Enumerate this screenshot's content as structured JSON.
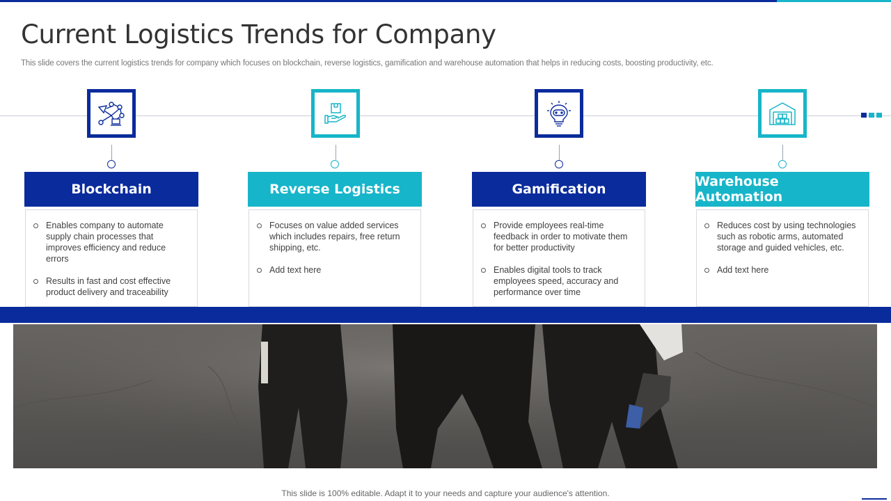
{
  "slide": {
    "title": "Current Logistics Trends for Company",
    "subtitle": "This slide covers the current logistics trends for company which focuses on blockchain, reverse logistics, gamification and warehouse automation that helps in reducing costs, boosting productivity, etc.",
    "footer": "This slide is 100% editable. Adapt it to your needs and capture your audience's attention."
  },
  "colors": {
    "navy": "#0a2b9c",
    "teal": "#17b5c9"
  },
  "trends": [
    {
      "heading": "Blockchain",
      "icon": "blockchain-network-icon",
      "accent": "navy",
      "points": [
        "Enables company to automate supply chain processes that improves efficiency and reduce errors",
        "Results in fast and cost effective product delivery and traceability"
      ]
    },
    {
      "heading": "Reverse Logistics",
      "icon": "hand-package-icon",
      "accent": "teal",
      "points": [
        "Focuses on value added services which includes repairs, free return shipping, etc.",
        "Add text here"
      ]
    },
    {
      "heading": "Gamification",
      "icon": "gamepad-bulb-icon",
      "accent": "navy",
      "points": [
        "Provide employees real-time feedback in order to motivate them for better productivity",
        "Enables digital tools to track employees speed, accuracy and performance over time"
      ]
    },
    {
      "heading": "Warehouse Automation",
      "icon": "warehouse-icon",
      "accent": "teal",
      "points": [
        "Reduces cost by using technologies such as robotic arms, automated storage and guided vehicles, etc.",
        "Add text here"
      ]
    }
  ]
}
